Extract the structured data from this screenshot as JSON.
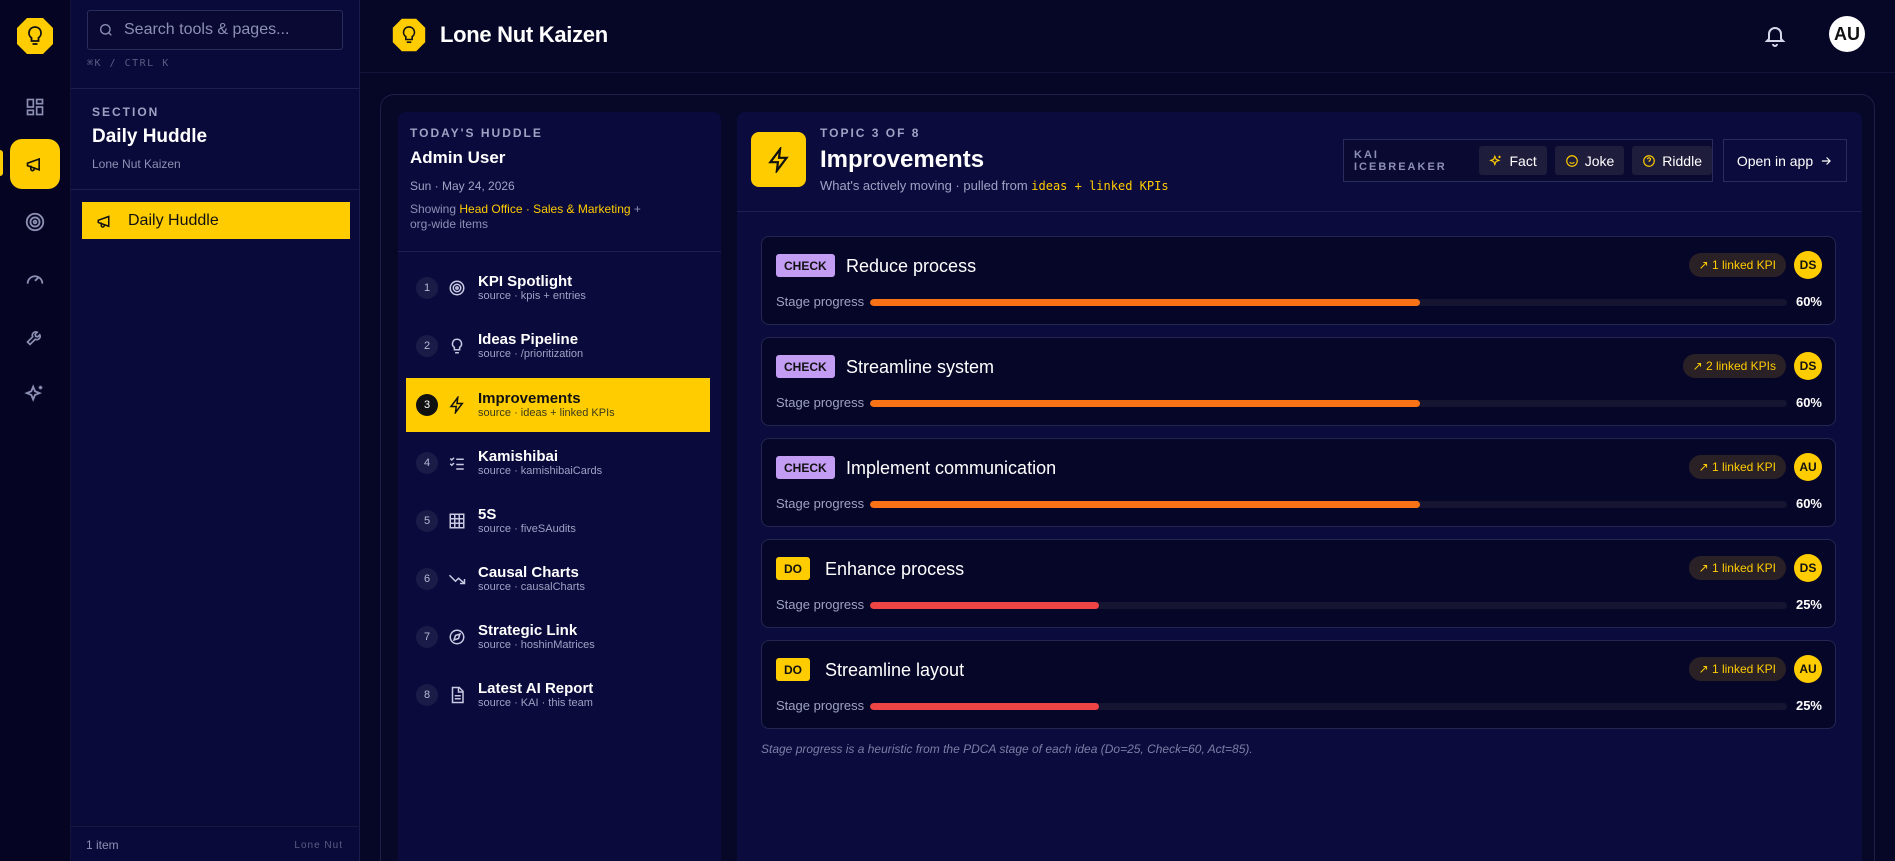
{
  "colors": {
    "accent": "#ffcc00",
    "background": "#060626",
    "check": "#c39cf3",
    "progress_orange": "#f97316",
    "progress_red": "#ef4444"
  },
  "search": {
    "placeholder": "Search tools & pages...",
    "shortcut": "⌘K / CTRL K"
  },
  "rail": {
    "items": [
      "dashboard-icon",
      "megaphone-icon",
      "target-icon",
      "gauge-icon",
      "wrench-icon",
      "sparkles-icon"
    ],
    "active": "megaphone-icon"
  },
  "sidebar": {
    "section_kicker": "SECTION",
    "section_title": "Daily Huddle",
    "section_sub": "Lone Nut Kaizen",
    "items": [
      {
        "label": "Daily Huddle",
        "icon": "megaphone-icon"
      }
    ],
    "footer_count": "1 item",
    "footer_brand": "Lone Nut"
  },
  "header": {
    "app_name": "Lone Nut Kaizen",
    "avatar": "AU"
  },
  "agenda": {
    "kicker": "TODAY'S HUDDLE",
    "user": "Admin User",
    "date": "Sun · May 24, 2026",
    "showing_prefix": "Showing ",
    "showing_scope": "Head Office · Sales & Marketing",
    "showing_suffix": " + org-wide items",
    "items": [
      {
        "num": "1",
        "name": "KPI Spotlight",
        "source": "source · kpis + entries",
        "icon": "target-icon"
      },
      {
        "num": "2",
        "name": "Ideas Pipeline",
        "source": "source · /prioritization",
        "icon": "lightbulb-icon"
      },
      {
        "num": "3",
        "name": "Improvements",
        "source": "source · ideas + linked KPIs",
        "icon": "bolt-icon"
      },
      {
        "num": "4",
        "name": "Kamishibai",
        "source": "source · kamishibaiCards",
        "icon": "checklist-icon"
      },
      {
        "num": "5",
        "name": "5S",
        "source": "source · fiveSAudits",
        "icon": "grid-icon"
      },
      {
        "num": "6",
        "name": "Causal Charts",
        "source": "source · causalCharts",
        "icon": "trend-down-icon"
      },
      {
        "num": "7",
        "name": "Strategic Link",
        "source": "source · hoshinMatrices",
        "icon": "compass-icon"
      },
      {
        "num": "8",
        "name": "Latest AI Report",
        "source": "source · KAI · this team",
        "icon": "document-icon"
      }
    ],
    "active_index": 2
  },
  "topic": {
    "kicker": "TOPIC 3 OF 8",
    "title": "Improvements",
    "subtitle_prefix": "What's actively moving · pulled from ",
    "subtitle_code": "ideas + linked KPIs",
    "icebreaker_label": "KAI ICEBREAKER",
    "icebreaker_buttons": [
      "Fact",
      "Joke",
      "Riddle"
    ],
    "open_label": "Open in app",
    "progress_label": "Stage progress",
    "cards": [
      {
        "stage": "CHECK",
        "title": "Reduce process",
        "kpi": "↗ 1 linked KPI",
        "owner": "DS",
        "progress": 60,
        "progress_text": "60%"
      },
      {
        "stage": "CHECK",
        "title": "Streamline system",
        "kpi": "↗ 2 linked KPIs",
        "owner": "DS",
        "progress": 60,
        "progress_text": "60%"
      },
      {
        "stage": "CHECK",
        "title": "Implement communication",
        "kpi": "↗ 1 linked KPI",
        "owner": "AU",
        "progress": 60,
        "progress_text": "60%"
      },
      {
        "stage": "DO",
        "title": "Enhance process",
        "kpi": "↗ 1 linked KPI",
        "owner": "DS",
        "progress": 25,
        "progress_text": "25%"
      },
      {
        "stage": "DO",
        "title": "Streamline layout",
        "kpi": "↗ 1 linked KPI",
        "owner": "AU",
        "progress": 25,
        "progress_text": "25%"
      }
    ],
    "footnote": "Stage progress is a heuristic from the PDCA stage of each idea (Do=25, Check=60, Act=85)."
  }
}
